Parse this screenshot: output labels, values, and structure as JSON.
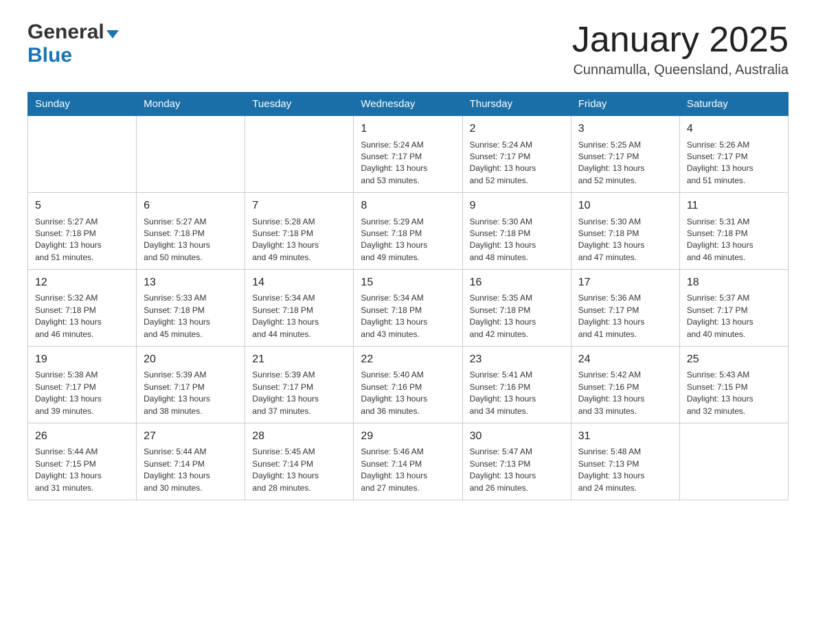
{
  "header": {
    "logo": {
      "general": "General",
      "blue": "Blue",
      "arrow": "▼"
    },
    "title": "January 2025",
    "location": "Cunnamulla, Queensland, Australia"
  },
  "calendar": {
    "days_of_week": [
      "Sunday",
      "Monday",
      "Tuesday",
      "Wednesday",
      "Thursday",
      "Friday",
      "Saturday"
    ],
    "weeks": [
      [
        {
          "day": "",
          "info": ""
        },
        {
          "day": "",
          "info": ""
        },
        {
          "day": "",
          "info": ""
        },
        {
          "day": "1",
          "info": "Sunrise: 5:24 AM\nSunset: 7:17 PM\nDaylight: 13 hours\nand 53 minutes."
        },
        {
          "day": "2",
          "info": "Sunrise: 5:24 AM\nSunset: 7:17 PM\nDaylight: 13 hours\nand 52 minutes."
        },
        {
          "day": "3",
          "info": "Sunrise: 5:25 AM\nSunset: 7:17 PM\nDaylight: 13 hours\nand 52 minutes."
        },
        {
          "day": "4",
          "info": "Sunrise: 5:26 AM\nSunset: 7:17 PM\nDaylight: 13 hours\nand 51 minutes."
        }
      ],
      [
        {
          "day": "5",
          "info": "Sunrise: 5:27 AM\nSunset: 7:18 PM\nDaylight: 13 hours\nand 51 minutes."
        },
        {
          "day": "6",
          "info": "Sunrise: 5:27 AM\nSunset: 7:18 PM\nDaylight: 13 hours\nand 50 minutes."
        },
        {
          "day": "7",
          "info": "Sunrise: 5:28 AM\nSunset: 7:18 PM\nDaylight: 13 hours\nand 49 minutes."
        },
        {
          "day": "8",
          "info": "Sunrise: 5:29 AM\nSunset: 7:18 PM\nDaylight: 13 hours\nand 49 minutes."
        },
        {
          "day": "9",
          "info": "Sunrise: 5:30 AM\nSunset: 7:18 PM\nDaylight: 13 hours\nand 48 minutes."
        },
        {
          "day": "10",
          "info": "Sunrise: 5:30 AM\nSunset: 7:18 PM\nDaylight: 13 hours\nand 47 minutes."
        },
        {
          "day": "11",
          "info": "Sunrise: 5:31 AM\nSunset: 7:18 PM\nDaylight: 13 hours\nand 46 minutes."
        }
      ],
      [
        {
          "day": "12",
          "info": "Sunrise: 5:32 AM\nSunset: 7:18 PM\nDaylight: 13 hours\nand 46 minutes."
        },
        {
          "day": "13",
          "info": "Sunrise: 5:33 AM\nSunset: 7:18 PM\nDaylight: 13 hours\nand 45 minutes."
        },
        {
          "day": "14",
          "info": "Sunrise: 5:34 AM\nSunset: 7:18 PM\nDaylight: 13 hours\nand 44 minutes."
        },
        {
          "day": "15",
          "info": "Sunrise: 5:34 AM\nSunset: 7:18 PM\nDaylight: 13 hours\nand 43 minutes."
        },
        {
          "day": "16",
          "info": "Sunrise: 5:35 AM\nSunset: 7:18 PM\nDaylight: 13 hours\nand 42 minutes."
        },
        {
          "day": "17",
          "info": "Sunrise: 5:36 AM\nSunset: 7:17 PM\nDaylight: 13 hours\nand 41 minutes."
        },
        {
          "day": "18",
          "info": "Sunrise: 5:37 AM\nSunset: 7:17 PM\nDaylight: 13 hours\nand 40 minutes."
        }
      ],
      [
        {
          "day": "19",
          "info": "Sunrise: 5:38 AM\nSunset: 7:17 PM\nDaylight: 13 hours\nand 39 minutes."
        },
        {
          "day": "20",
          "info": "Sunrise: 5:39 AM\nSunset: 7:17 PM\nDaylight: 13 hours\nand 38 minutes."
        },
        {
          "day": "21",
          "info": "Sunrise: 5:39 AM\nSunset: 7:17 PM\nDaylight: 13 hours\nand 37 minutes."
        },
        {
          "day": "22",
          "info": "Sunrise: 5:40 AM\nSunset: 7:16 PM\nDaylight: 13 hours\nand 36 minutes."
        },
        {
          "day": "23",
          "info": "Sunrise: 5:41 AM\nSunset: 7:16 PM\nDaylight: 13 hours\nand 34 minutes."
        },
        {
          "day": "24",
          "info": "Sunrise: 5:42 AM\nSunset: 7:16 PM\nDaylight: 13 hours\nand 33 minutes."
        },
        {
          "day": "25",
          "info": "Sunrise: 5:43 AM\nSunset: 7:15 PM\nDaylight: 13 hours\nand 32 minutes."
        }
      ],
      [
        {
          "day": "26",
          "info": "Sunrise: 5:44 AM\nSunset: 7:15 PM\nDaylight: 13 hours\nand 31 minutes."
        },
        {
          "day": "27",
          "info": "Sunrise: 5:44 AM\nSunset: 7:14 PM\nDaylight: 13 hours\nand 30 minutes."
        },
        {
          "day": "28",
          "info": "Sunrise: 5:45 AM\nSunset: 7:14 PM\nDaylight: 13 hours\nand 28 minutes."
        },
        {
          "day": "29",
          "info": "Sunrise: 5:46 AM\nSunset: 7:14 PM\nDaylight: 13 hours\nand 27 minutes."
        },
        {
          "day": "30",
          "info": "Sunrise: 5:47 AM\nSunset: 7:13 PM\nDaylight: 13 hours\nand 26 minutes."
        },
        {
          "day": "31",
          "info": "Sunrise: 5:48 AM\nSunset: 7:13 PM\nDaylight: 13 hours\nand 24 minutes."
        },
        {
          "day": "",
          "info": ""
        }
      ]
    ]
  }
}
